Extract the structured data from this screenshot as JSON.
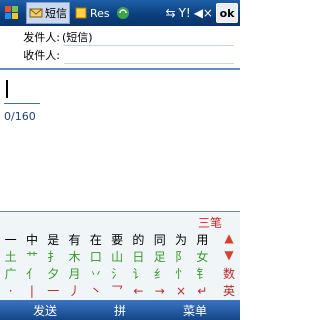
{
  "status": {
    "tab1_label": "短信",
    "tab2_label": "Res",
    "ok_label": "ok"
  },
  "fields": {
    "from_label": "发件人:",
    "from_value": "(短信)",
    "to_label": "收件人:",
    "to_value": ""
  },
  "message": {
    "counter": "0/160"
  },
  "ime": {
    "mode_label": "三笔",
    "candidates": [
      "一",
      "中",
      "是",
      "有",
      "在",
      "要",
      "的",
      "同",
      "为",
      "用"
    ],
    "row2": [
      "土",
      "艹",
      "扌",
      "木",
      "口",
      "山",
      "日",
      "足",
      "阝",
      "女"
    ],
    "row3": [
      "广",
      "亻",
      "夕",
      "月",
      "丷",
      "氵",
      "讠",
      "纟",
      "忄",
      "钅"
    ],
    "row4": [
      "·",
      "|",
      "一",
      "丿",
      "丶",
      "乛",
      "←",
      "→",
      "×",
      "↵"
    ],
    "side_up": "▲",
    "side_down": "▼",
    "side_num": "数",
    "side_en": "英",
    "side_sym": "标"
  },
  "softkeys": {
    "left": "发送",
    "middle": "拼",
    "right": "菜单"
  },
  "colors": {
    "accent": "#0b3e7c",
    "radical_green": "#3b9a2c",
    "mode_red": "#d22222"
  }
}
